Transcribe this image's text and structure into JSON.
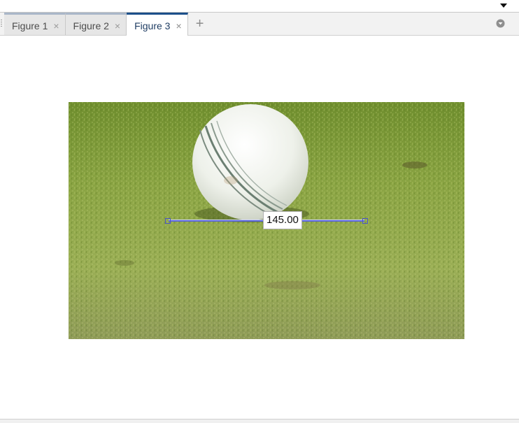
{
  "tabs": [
    {
      "label": "Figure 1",
      "close": "×",
      "active": false
    },
    {
      "label": "Figure 2",
      "close": "×",
      "active": false
    },
    {
      "label": "Figure 3",
      "close": "×",
      "active": true
    }
  ],
  "add_tab_symbol": "+",
  "icons": {
    "toolbar_dropdown": "caret-down-icon",
    "tab_menu": "circle-chevron-down-icon",
    "grip": "grip-icon"
  },
  "figure": {
    "image_subject": "cricket ball on grass",
    "distance_tool": {
      "value": 145.0,
      "value_text": "145.00"
    }
  },
  "colors": {
    "active_tab_accent": "#1c4f8a",
    "inactive_tab_accent": "#a9b6c8",
    "distance_line": "#5a66d8",
    "grass": "#7f9a3c"
  }
}
